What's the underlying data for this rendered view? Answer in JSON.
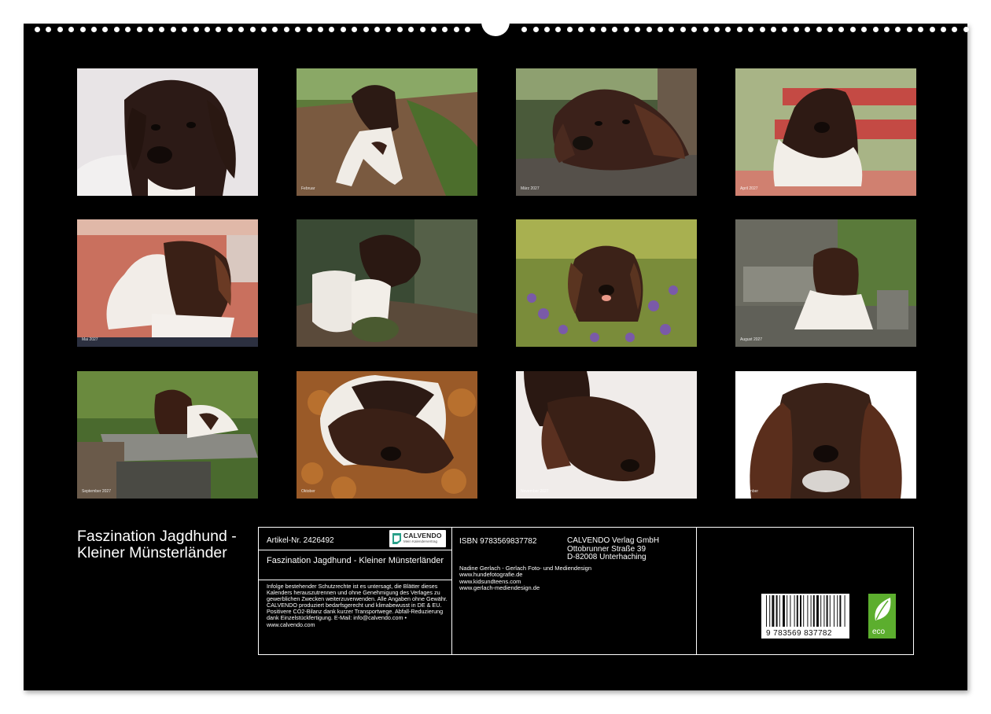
{
  "photos": [
    {
      "month": ""
    },
    {
      "month": "Februar"
    },
    {
      "month": "März 2027"
    },
    {
      "month": "April 2027"
    },
    {
      "month": "Mai 2027"
    },
    {
      "month": ""
    },
    {
      "month": ""
    },
    {
      "month": "August 2027"
    },
    {
      "month": "September 2027"
    },
    {
      "month": "Oktober"
    },
    {
      "month": "November 2027"
    },
    {
      "month": "Dezember"
    }
  ],
  "title": "Faszination Jagdhund - Kleiner Münsterländer",
  "info": {
    "article": "Artikel-Nr. 2426492",
    "logo_name": "CALVENDO",
    "logo_sub": "Mein Kalendervertrag",
    "calendar_name": "Faszination Jagdhund - Kleiner Münsterländer",
    "legal": "Infolge bestehender Schutzrechte ist es untersagt, die Blätter dieses Kalenders herauszutrennen und ohne Genehmigung des Verlages zu gewerblichen Zwecken weiterzuverwenden. Alle Angaben ohne Gewähr. CALVENDO produziert bedarfsgerecht und klimabewusst in DE & EU. Positivere CO2-Bilanz dank kurzer Transportwege. Abfall-Reduzierung dank Einzelstückfertigung. E-Mail: info@calvendo.com • www.calvendo.com",
    "isbn": "ISBN 9783569837782",
    "publisher_line1": "CALVENDO Verlag GmbH",
    "publisher_line2": "Ottobrunner Straße 39",
    "publisher_line3": "D-82008 Unterhaching",
    "author_line1": "Nadine Gerlach - Gerlach Foto- und Mediendesign",
    "author_line2": "www.hundefotografie.de",
    "author_line3": "www.kidsundteens.com",
    "author_line4": "www.gerlach-mediendesign.de",
    "barcode_number": "9 783569 837782",
    "eco_label": "eco"
  },
  "colors": {
    "background": "#000000",
    "eco_green": "#5cae2e",
    "dog_brown": "#3a2018"
  }
}
